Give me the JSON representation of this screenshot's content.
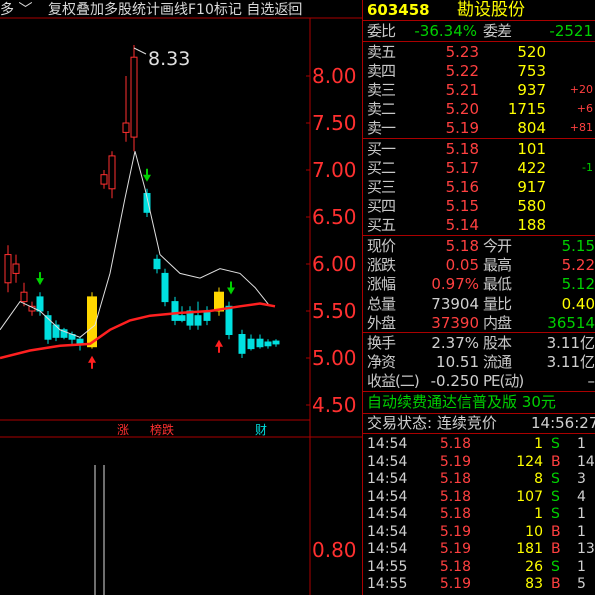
{
  "toolbar": {
    "left_text": "多 ﹀",
    "menu_text": "复权叠加多股统计画线F10标记 自选返回",
    "icon": "diamond-icon"
  },
  "chart": {
    "price_labels": [
      "8.00",
      "7.50",
      "7.00",
      "6.50",
      "6.00",
      "5.50",
      "5.00",
      "4.50"
    ],
    "high_annotation": "8.33",
    "sub_label": "0.80",
    "tags": [
      "涨",
      "榜跌",
      "财"
    ],
    "colors": {
      "up": "#ff3030",
      "down": "#00e0e0",
      "highlight": "#ffd700",
      "ma_white": "#e0e0e0",
      "ma_red": "#ff2020"
    }
  },
  "quote": {
    "code": "603458",
    "name": "勘设股份",
    "weibi_label": "委比",
    "weibi_value": "-36.34%",
    "weicha_label": "委差",
    "weicha_value": "-2521",
    "sells": [
      {
        "label": "卖五",
        "price": "5.23",
        "vol": "520",
        "chg": ""
      },
      {
        "label": "卖四",
        "price": "5.22",
        "vol": "753",
        "chg": ""
      },
      {
        "label": "卖三",
        "price": "5.21",
        "vol": "937",
        "chg": "+20"
      },
      {
        "label": "卖二",
        "price": "5.20",
        "vol": "1715",
        "chg": "+6"
      },
      {
        "label": "卖一",
        "price": "5.19",
        "vol": "804",
        "chg": "+81"
      }
    ],
    "buys": [
      {
        "label": "买一",
        "price": "5.18",
        "vol": "101",
        "chg": ""
      },
      {
        "label": "买二",
        "price": "5.17",
        "vol": "422",
        "chg": "-1"
      },
      {
        "label": "买三",
        "price": "5.16",
        "vol": "917",
        "chg": ""
      },
      {
        "label": "买四",
        "price": "5.15",
        "vol": "580",
        "chg": ""
      },
      {
        "label": "买五",
        "price": "5.14",
        "vol": "188",
        "chg": ""
      }
    ],
    "stats": [
      {
        "l1": "现价",
        "v1": "5.18",
        "l2": "今开",
        "v2": "5.15"
      },
      {
        "l1": "涨跌",
        "v1": "0.05",
        "l2": "最高",
        "v2": "5.22"
      },
      {
        "l1": "涨幅",
        "v1": "0.97%",
        "l2": "最低",
        "v2": "5.12"
      },
      {
        "l1": "总量",
        "v1": "73904",
        "l2": "量比",
        "v2": "0.40"
      },
      {
        "l1": "外盘",
        "v1": "37390",
        "l2": "内盘",
        "v2": "36514"
      }
    ],
    "stats2": [
      {
        "l1": "换手",
        "v1": "2.37%",
        "l2": "股本",
        "v2": "3.11亿"
      },
      {
        "l1": "净资",
        "v1": "10.51",
        "l2": "流通",
        "v2": "3.11亿"
      },
      {
        "l1": "收益(二)",
        "v1": "-0.250",
        "l2": "PE(动)",
        "v2": "–"
      }
    ],
    "ad_text": "自动续费通达信普及版  30元",
    "status_text": "交易状态: 连续竞价",
    "status_time": "14:56:27",
    "trades": [
      {
        "time": "14:54",
        "price": "5.18",
        "vol": "1",
        "side": "S",
        "n": "1"
      },
      {
        "time": "14:54",
        "price": "5.19",
        "vol": "124",
        "side": "B",
        "n": "14"
      },
      {
        "time": "14:54",
        "price": "5.18",
        "vol": "8",
        "side": "S",
        "n": "3"
      },
      {
        "time": "14:54",
        "price": "5.18",
        "vol": "107",
        "side": "S",
        "n": "4"
      },
      {
        "time": "14:54",
        "price": "5.18",
        "vol": "1",
        "side": "S",
        "n": "1"
      },
      {
        "time": "14:54",
        "price": "5.19",
        "vol": "10",
        "side": "B",
        "n": "1"
      },
      {
        "time": "14:54",
        "price": "5.19",
        "vol": "181",
        "side": "B",
        "n": "13"
      },
      {
        "time": "14:55",
        "price": "5.18",
        "vol": "26",
        "side": "S",
        "n": "1"
      },
      {
        "time": "14:55",
        "price": "5.19",
        "vol": "83",
        "side": "B",
        "n": "5"
      }
    ]
  }
}
